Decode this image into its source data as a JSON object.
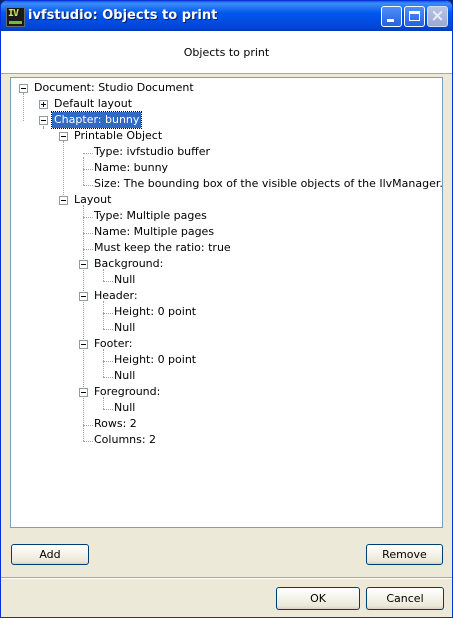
{
  "window": {
    "title": "ivfstudio: Objects to print",
    "icon": "ivfstudio-app-icon",
    "icon_text": "IV"
  },
  "header": {
    "title": "Objects to print"
  },
  "tree": {
    "document": "Document: Studio Document",
    "default_layout": "Default layout",
    "chapter": "Chapter: bunny",
    "printable_object": "Printable Object",
    "po_type": "Type: ivfstudio buffer",
    "po_name": "Name: bunny",
    "po_size": "Size: The bounding box of the visible objects of the IlvManager.",
    "layout": "Layout",
    "layout_type": "Type: Multiple pages",
    "layout_name": "Name: Multiple pages",
    "layout_ratio": "Must keep the ratio: true",
    "background": "Background:",
    "background_null": "Null",
    "header": "Header:",
    "header_height": "Height: 0 point",
    "header_null": "Null",
    "footer": "Footer:",
    "footer_height": "Height: 0 point",
    "footer_null": "Null",
    "foreground": "Foreground:",
    "foreground_null": "Null",
    "rows": "Rows: 2",
    "columns": "Columns: 2"
  },
  "buttons": {
    "add": "Add",
    "remove": "Remove",
    "ok": "OK",
    "cancel": "Cancel"
  }
}
